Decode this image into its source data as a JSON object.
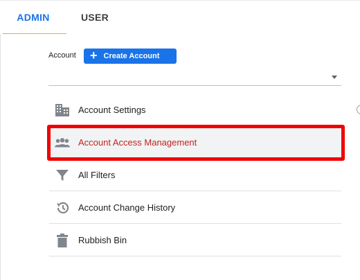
{
  "tabs": [
    {
      "label": "ADMIN",
      "active": true
    },
    {
      "label": "USER",
      "active": false
    }
  ],
  "account": {
    "label": "Account",
    "create_button": "Create Account",
    "selected_value": ""
  },
  "menu": [
    {
      "label": "Account Settings",
      "icon": "building-icon"
    },
    {
      "label": "Account Access Management",
      "icon": "people-icon",
      "selected": true
    },
    {
      "label": "All Filters",
      "icon": "filter-icon"
    },
    {
      "label": "Account Change History",
      "icon": "history-icon"
    },
    {
      "label": "Rubbish Bin",
      "icon": "trash-icon"
    }
  ],
  "colors": {
    "accent": "#1a73e8",
    "tab_underline": "#f5a524",
    "highlight": "#f00000",
    "selected_text": "#c5221f"
  }
}
